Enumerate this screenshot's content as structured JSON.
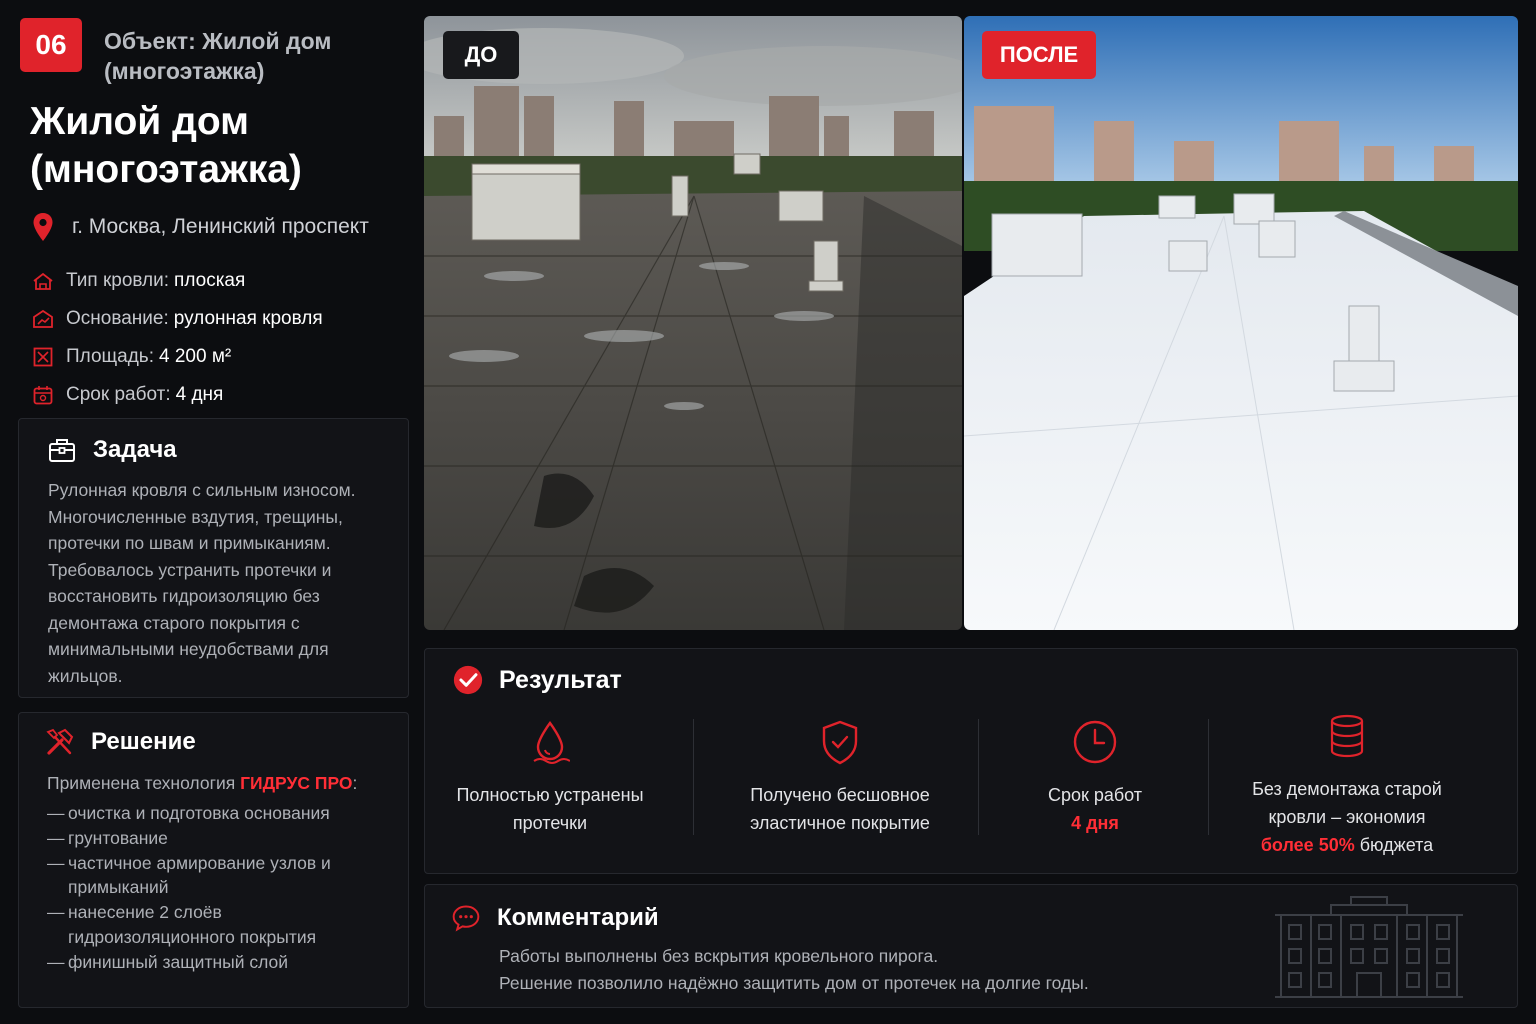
{
  "project": {
    "number": "06",
    "object_label": "Объект: Жилой дом (многоэтажка)",
    "title": "Жилой дом (многоэтажка)",
    "address": "г. Москва, Ленинский проспект"
  },
  "properties": [
    {
      "icon": "roof-icon",
      "label": "Тип кровли:",
      "value": "плоская"
    },
    {
      "icon": "base-icon",
      "label": "Основание:",
      "value": "рулонная кровля"
    },
    {
      "icon": "area-icon",
      "label": "Площадь:",
      "value": "4 200 м²"
    },
    {
      "icon": "calendar-icon",
      "label": "Срок работ:",
      "value": "4 дня"
    }
  ],
  "task": {
    "title": "Задача",
    "text": "Рулонная кровля с сильным износом. Многочисленные вздутия, трещины, протечки по швам и примыканиям. Требовалось устранить протечки и восстановить гидроизоляцию без демонтажа старого покрытия с минимальными неудобствами для жильцов."
  },
  "solution": {
    "title": "Решение",
    "intro_before": "Применена технология ",
    "tech_name": "ГИДРУС ПРО",
    "intro_after": ":",
    "steps": [
      "очистка и подготовка основания",
      "грунтование",
      "частичное армирование узлов и примыканий",
      "нанесение 2 слоёв гидроизоляционного покрытия",
      "финишный защитный слой"
    ]
  },
  "photos": {
    "before_label": "ДО",
    "after_label": "ПОСЛЕ"
  },
  "result": {
    "title": "Результат",
    "items": [
      {
        "icon": "water-drop-icon",
        "text": "Полностью устранены протечки"
      },
      {
        "icon": "shield-check-icon",
        "text": "Получено бесшовное эластичное покрытие"
      },
      {
        "icon": "clock-icon",
        "text": "Срок работ",
        "highlight": "4 дня"
      },
      {
        "icon": "coins-icon",
        "text_before": "Без демонтажа старой кровли – экономия",
        "highlight": "более 50%",
        "text_after": "бюджета"
      }
    ]
  },
  "comment": {
    "title": "Комментарий",
    "lines": [
      "Работы выполнены без вскрытия кровельного пирога.",
      "Решение позволило надёжно защитить дом от протечек на долгие годы."
    ]
  },
  "colors": {
    "accent": "#e0232b",
    "background": "#0c0d10",
    "card": "#121317"
  }
}
